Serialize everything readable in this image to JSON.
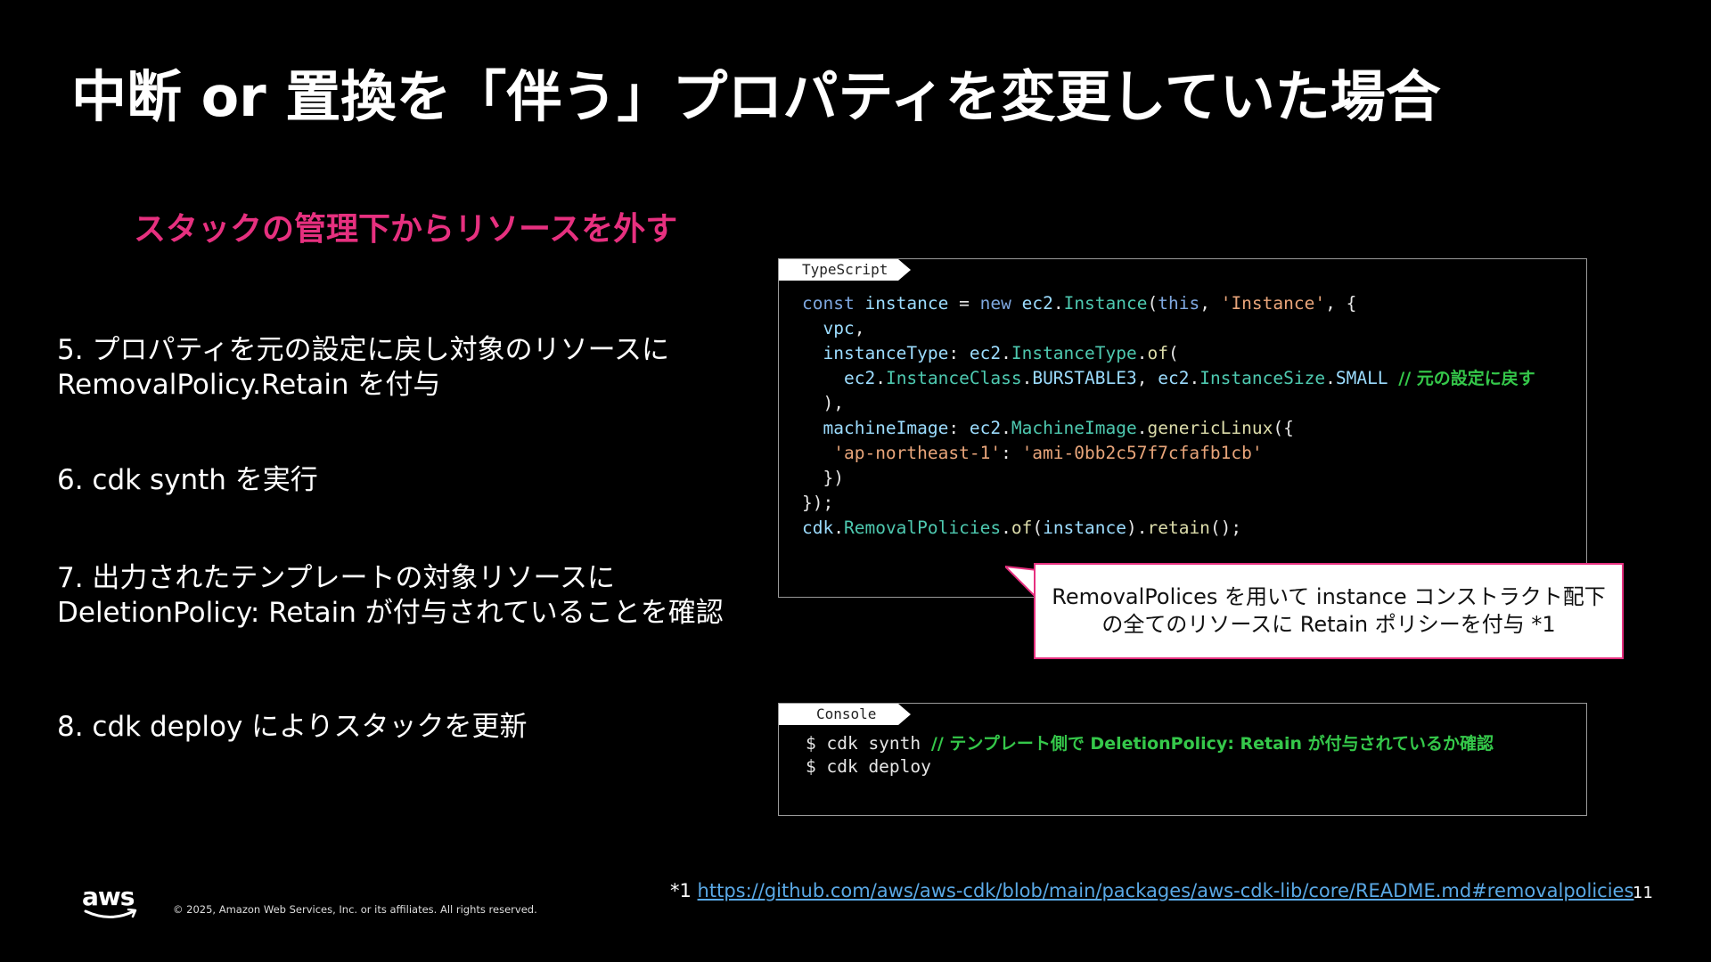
{
  "title": "中断 or 置換を「伴う」プロパティを変更していた場合",
  "subtitle": "スタックの管理下からリソースを外す",
  "steps": [
    {
      "line1": "5. プロパティを元の設定に戻し対象のリソースに",
      "line2": "RemovalPolicy.Retain を付与"
    },
    {
      "line1": "6. cdk synth を実行",
      "line2": ""
    },
    {
      "line1": "7. 出力されたテンプレートの対象リソースに",
      "line2": "DeletionPolicy: Retain が付与されていることを確認"
    },
    {
      "line1": "8. cdk deploy によりスタックを更新",
      "line2": ""
    }
  ],
  "typescript_box": {
    "tab_label": "TypeScript",
    "comment": "// 元の設定に戻す"
  },
  "console_box": {
    "tab_label": "Console",
    "line1_cmd": "$ cdk synth ",
    "line1_comment": "// テンプレート側で DeletionPolicy: Retain が付与されているか確認",
    "line2_cmd": "$ cdk deploy"
  },
  "callout": {
    "line1": "RemovalPolices を用いて instance コンストラクト配下",
    "line2": "の全てのリソースに Retain ポリシーを付与 *1",
    "border_color": "#e6307f"
  },
  "footnote": {
    "prefix": "*1 ",
    "link_text": "https://github.com/aws/aws-cdk/blob/main/packages/aws-cdk-lib/core/README.md#removalpolicies"
  },
  "page_number": "11",
  "footer": {
    "logo_text": "aws",
    "copyright": "© 2025, Amazon Web Services, Inc. or its affiliates. All rights reserved."
  },
  "colors": {
    "background": "#000000",
    "accent_pink": "#e6307f",
    "comment_green": "#35c84a",
    "link_blue": "#5aa9e6"
  }
}
